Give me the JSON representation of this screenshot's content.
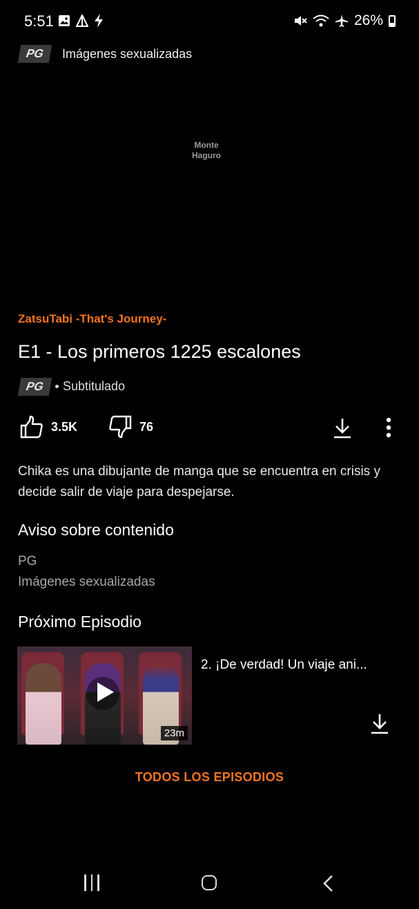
{
  "status_bar": {
    "time": "5:51",
    "battery": "26%"
  },
  "top_rating": {
    "badge": "PG",
    "text": "Imágenes sexualizadas"
  },
  "player": {
    "watermark_line1": "Monte",
    "watermark_line2": "Haguro"
  },
  "episode": {
    "series": "ZatsuTabi -That's Journey-",
    "title": "E1 - Los primeros 1225 escalones",
    "rating_badge": "PG",
    "audio": "Subtitulado",
    "likes": "3.5K",
    "dislikes": "76",
    "description": "Chika es una dibujante de manga que se encuentra en crisis y decide salir de viaje para despejarse."
  },
  "content_warning": {
    "heading": "Aviso sobre contenido",
    "rating": "PG",
    "descriptor": "Imágenes sexualizadas"
  },
  "next_episode": {
    "heading": "Próximo Episodio",
    "title": "2. ¡De verdad! Un viaje ani...",
    "duration": "23m"
  },
  "all_episodes_label": "TODOS LOS EPISODIOS",
  "colors": {
    "accent": "#f47521",
    "background": "#000000"
  },
  "icons": {
    "like": "thumbs-up-icon",
    "dislike": "thumbs-down-icon",
    "download": "download-icon",
    "more": "more-vertical-icon",
    "play": "play-icon"
  }
}
